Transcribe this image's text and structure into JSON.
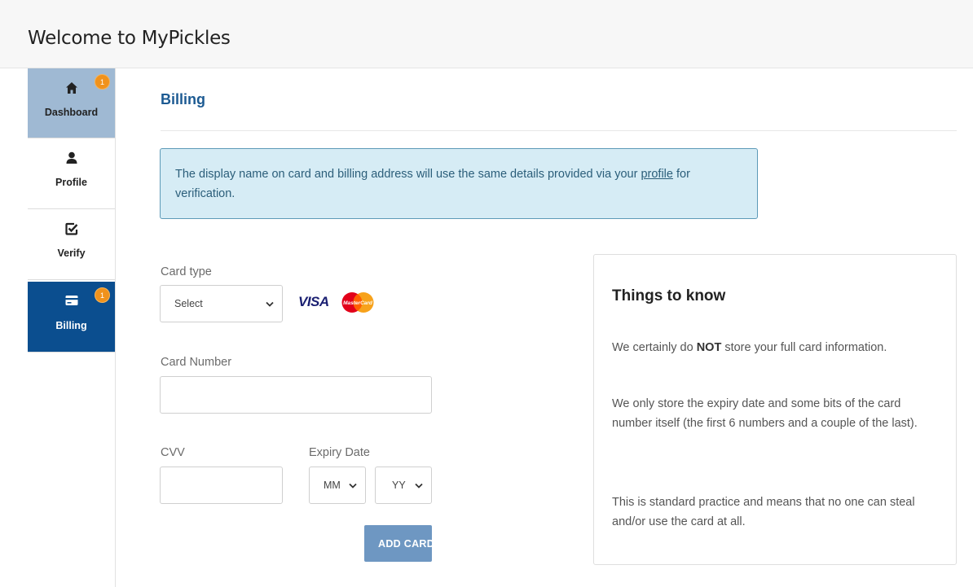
{
  "app": {
    "title": "Welcome to MyPickles"
  },
  "sidebar": {
    "items": [
      {
        "label": "Dashboard",
        "icon": "home-icon",
        "badge": "1"
      },
      {
        "label": "Profile",
        "icon": "user-icon"
      },
      {
        "label": "Verify",
        "icon": "check-square-icon"
      },
      {
        "label": "Billing",
        "icon": "credit-card-icon",
        "badge": "1"
      }
    ]
  },
  "main": {
    "title": "Billing",
    "notice": {
      "text_before": "The display name on card and billing address will use the same details provided via your ",
      "link": "profile",
      "text_after": " for verification."
    },
    "form": {
      "card_type_label": "Card type",
      "card_type_value": "Select",
      "visa_logo": "VISA",
      "mastercard_logo": "MasterCard",
      "card_number_label": "Card Number",
      "card_number_value": "",
      "cvv_label": "CVV",
      "cvv_value": "",
      "expiry_label": "Expiry Date",
      "month_value": "MM",
      "year_value": "YY",
      "add_button": "ADD CARD"
    },
    "info_panel": {
      "title": "Things to know",
      "p1_before": "We certainly do ",
      "p1_bold": "NOT",
      "p1_after": " store your full card information.",
      "p2": "We only store the expiry date and some bits of the card number itself (the first 6 numbers and a couple of the last).",
      "p3": "This is standard practice and means that no one can steal and/or use the card at all."
    }
  },
  "colors": {
    "accent": "#0b4e8f",
    "dashboard_bg": "#9fb9d3",
    "badge": "#f0921c",
    "button": "#6e97c2",
    "notice_bg": "#d6ecf5"
  }
}
